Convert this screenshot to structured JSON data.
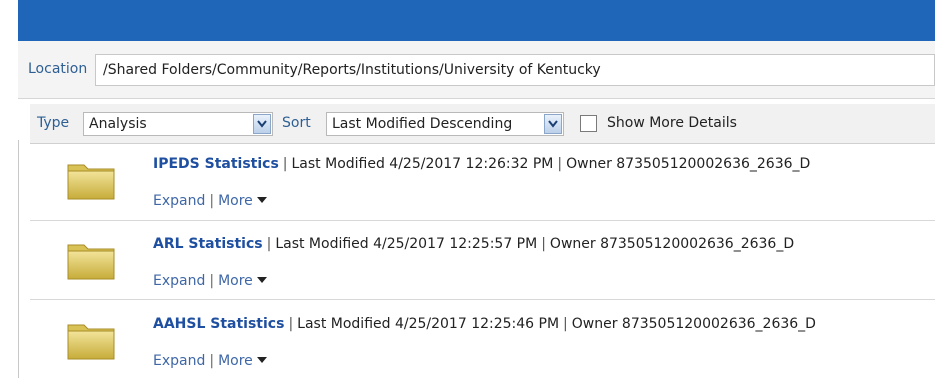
{
  "location": {
    "label": "Location",
    "path": "/Shared Folders/Community/Reports/Institutions/University of Kentucky"
  },
  "filters": {
    "type_label": "Type",
    "type_value": "Analysis",
    "sort_label": "Sort",
    "sort_value": "Last Modified Descending",
    "show_more_label": "Show More Details"
  },
  "items": [
    {
      "title": "IPEDS Statistics",
      "modified": "Last Modified 4/25/2017 12:26:32 PM",
      "owner": "Owner 873505120002636_2636_D",
      "expand": "Expand",
      "more": "More"
    },
    {
      "title": "ARL Statistics",
      "modified": "Last Modified 4/25/2017 12:25:57 PM",
      "owner": "Owner 873505120002636_2636_D",
      "expand": "Expand",
      "more": "More"
    },
    {
      "title": "AAHSL Statistics",
      "modified": "Last Modified 4/25/2017 12:25:46 PM",
      "owner": "Owner 873505120002636_2636_D",
      "expand": "Expand",
      "more": "More"
    }
  ],
  "colors": {
    "header": "#1f65b8",
    "link": "#1f4fa0"
  }
}
